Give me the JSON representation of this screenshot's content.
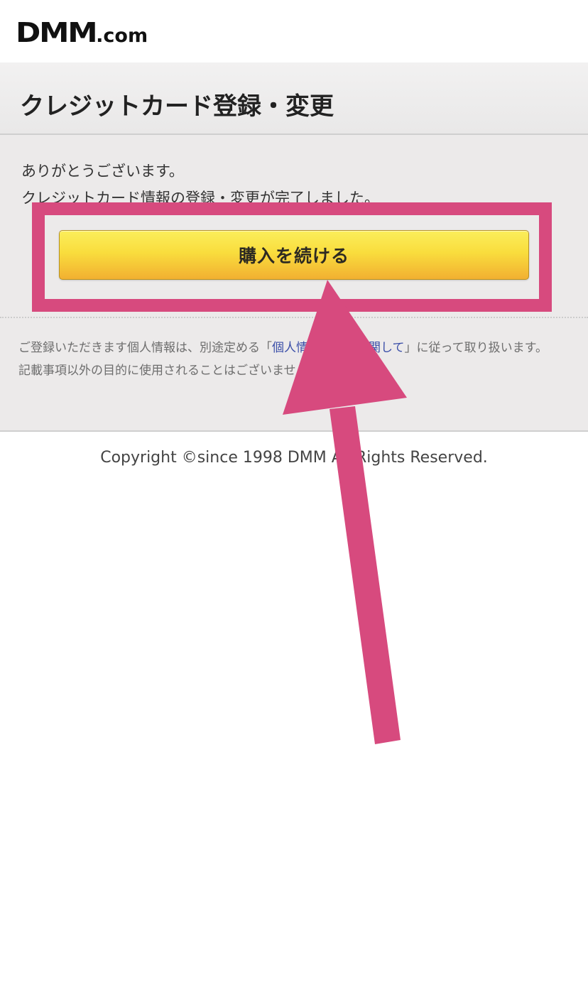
{
  "header": {
    "logo_main": "DMM",
    "logo_suffix": ".com"
  },
  "page": {
    "title": "クレジットカード登録・変更"
  },
  "message": {
    "line1": "ありがとうございます。",
    "line2": "クレジットカード情報の登録・変更が完了しました。"
  },
  "actions": {
    "continue_label": "購入を続ける"
  },
  "notice": {
    "text_before_link": "ご登録いただきます個人情報は、別途定める「",
    "link_text": "個人情報の保護に関して",
    "text_after_link": "」に従って取り扱います。",
    "line2": "記載事項以外の目的に使用されることはございません。"
  },
  "footer": {
    "copyright": "Copyright ©since 1998 DMM All Rights Reserved."
  },
  "annotation": {
    "highlight_color": "#d74a7e"
  }
}
